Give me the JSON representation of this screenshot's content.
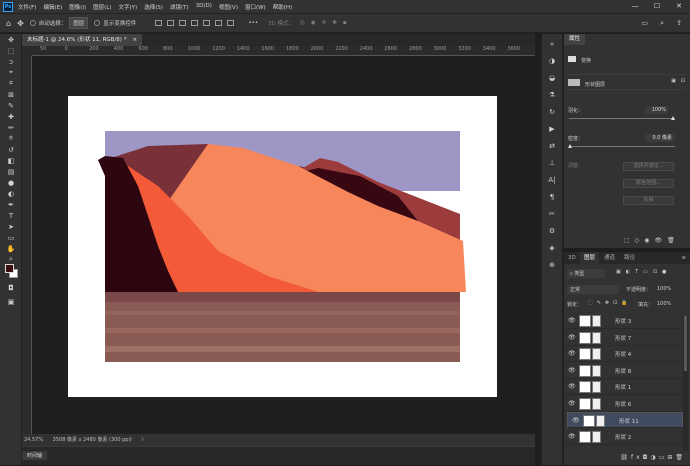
{
  "menu": [
    "文件(F)",
    "编辑(E)",
    "图像(I)",
    "图层(L)",
    "文字(Y)",
    "选择(S)",
    "滤镜(T)",
    "3D(D)",
    "视图(V)",
    "窗口(W)",
    "帮助(H)"
  ],
  "window_controls": {
    "minimize": "—",
    "maximize": "☐",
    "close": "✕"
  },
  "options": {
    "auto_select_label": "自动选择：",
    "auto_select_value": "图层",
    "show_transform_label": "显示变换控件",
    "mode_3d_label": "3D 模式：",
    "more": "•••"
  },
  "document": {
    "tab_title": "未标题-1 @ 24.6% (形状 11, RGB/8) *",
    "close": "×"
  },
  "ruler_ticks": [
    "50",
    "0",
    "200",
    "400",
    "600",
    "800",
    "1000",
    "1200",
    "1400",
    "1600",
    "1800",
    "2000",
    "2200",
    "2400",
    "2600",
    "2800",
    "3000",
    "3200",
    "3400",
    "3600"
  ],
  "status": {
    "zoom": "24.57%",
    "doc_size": "3508 像素 x 2480 像素 (300 ppi)",
    "arrow": "〉"
  },
  "timeline_label": "时间轴",
  "properties": {
    "tab": "属性",
    "transform_label": "变换",
    "shape_layer_label": "形状图层",
    "feather_label": "羽化：",
    "feather_value": "100%",
    "density_label": "密度：",
    "density_value": "0.0 像素",
    "refine_label": "调整：",
    "select_mask_btn": "选择并遮住...",
    "color_range_btn": "颜色范围...",
    "invert_btn": "反相"
  },
  "layers_panel": {
    "tabs": [
      "3D",
      "图层",
      "通道",
      "路径"
    ],
    "kind_label": "类型",
    "blend_mode": "正常",
    "opacity_label": "不透明度：",
    "opacity_value": "100%",
    "lock_label": "锁定：",
    "fill_label": "填充：",
    "fill_value": "100%",
    "layers": [
      "形状 3",
      "形状 7",
      "形状 4",
      "形状 8",
      "形状 1",
      "形状 6",
      "形状 11",
      "形状 2"
    ],
    "selected_layer": "形状 11"
  },
  "colors": {
    "foreground": "#3a0d10",
    "background": "#ffffff",
    "selected_layer": "#3f4c60",
    "accent": "#31a8ff"
  }
}
